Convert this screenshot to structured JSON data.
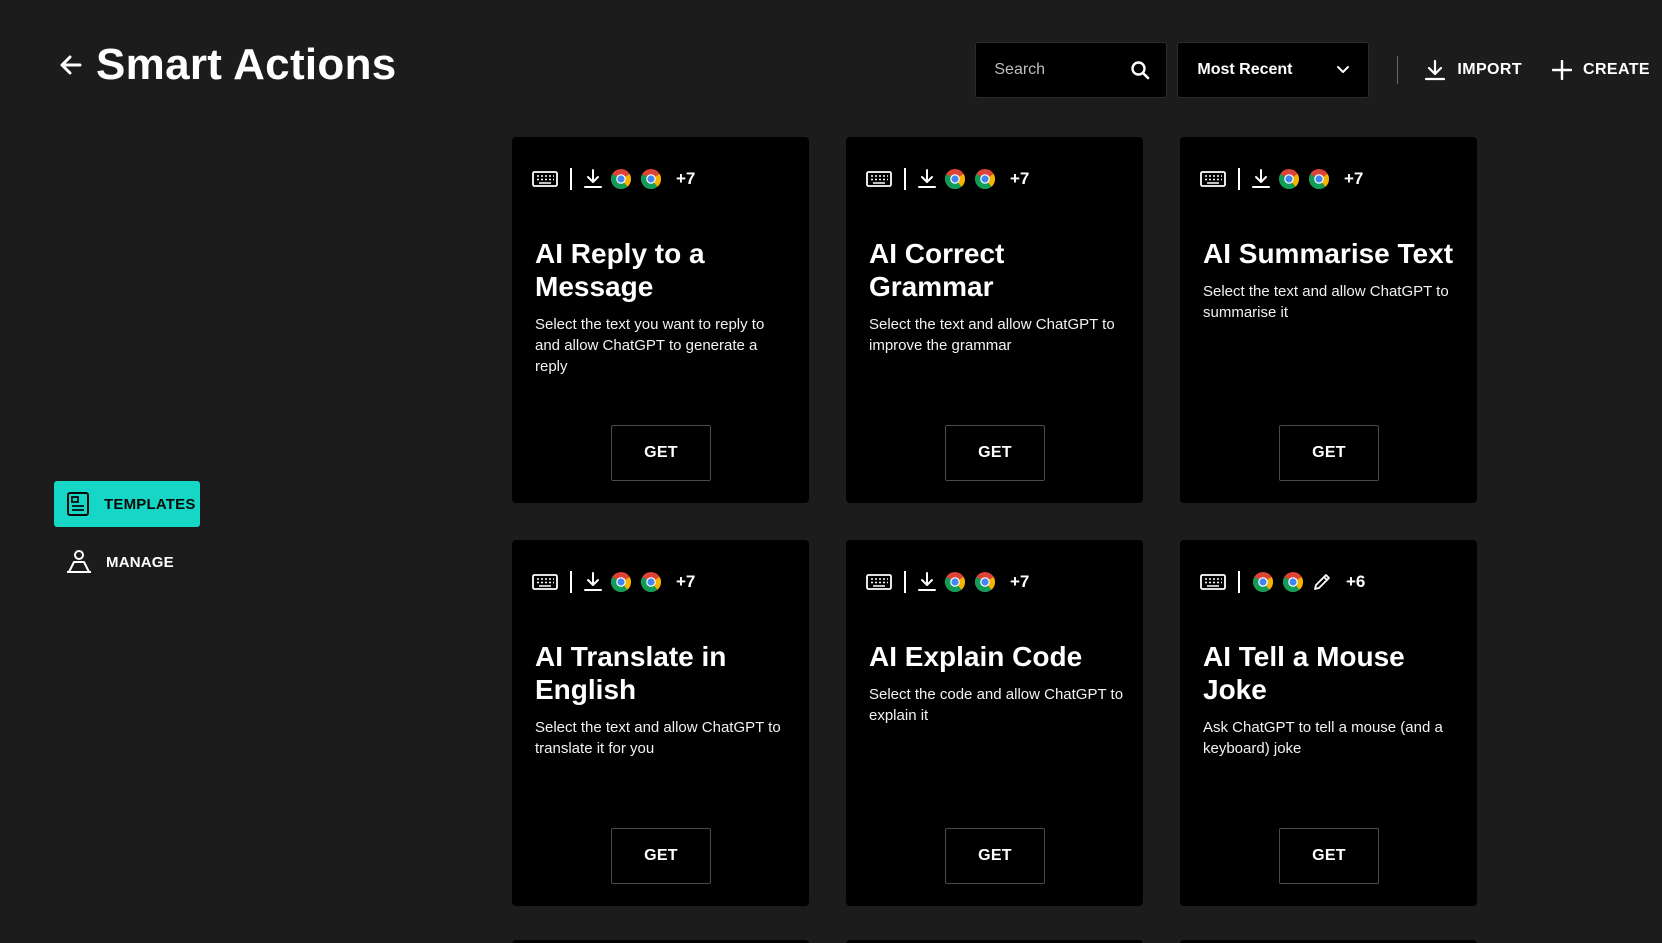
{
  "header": {
    "title": "Smart Actions",
    "search_placeholder": "Search",
    "sort_selected": "Most Recent",
    "import_label": "IMPORT",
    "create_label": "CREATE"
  },
  "sidebar": {
    "items": [
      {
        "label": "TEMPLATES",
        "icon": "templates-icon",
        "active": true
      },
      {
        "label": "MANAGE",
        "icon": "manage-icon",
        "active": false
      }
    ]
  },
  "colors": {
    "accent": "#16d6c5",
    "background": "#1c1c1c",
    "card": "#000000"
  },
  "cards": [
    {
      "title": "AI Reply to a Message",
      "description": "Select the text you want to reply to and allow ChatGPT to generate a reply",
      "icons": [
        "keyboard-icon",
        "download-icon",
        "chrome-icon",
        "chrome-icon"
      ],
      "more_count": "+7",
      "button_label": "GET"
    },
    {
      "title": "AI Correct Grammar",
      "description": "Select the text and allow ChatGPT to improve the grammar",
      "icons": [
        "keyboard-icon",
        "download-icon",
        "chrome-icon",
        "chrome-icon"
      ],
      "more_count": "+7",
      "button_label": "GET"
    },
    {
      "title": "AI Summarise Text",
      "description": "Select the text and allow ChatGPT to summarise it",
      "icons": [
        "keyboard-icon",
        "download-icon",
        "chrome-icon",
        "chrome-icon"
      ],
      "more_count": "+7",
      "button_label": "GET"
    },
    {
      "title": "AI Translate in English",
      "description": "Select the text and allow ChatGPT to translate it for you",
      "icons": [
        "keyboard-icon",
        "download-icon",
        "chrome-icon",
        "chrome-icon"
      ],
      "more_count": "+7",
      "button_label": "GET"
    },
    {
      "title": "AI Explain Code",
      "description": "Select the code and allow ChatGPT to explain it",
      "icons": [
        "keyboard-icon",
        "download-icon",
        "chrome-icon",
        "chrome-icon"
      ],
      "more_count": "+7",
      "button_label": "GET"
    },
    {
      "title": "AI Tell a Mouse Joke",
      "description": "Ask ChatGPT to tell a mouse (and a keyboard) joke",
      "icons": [
        "keyboard-icon",
        "chrome-icon",
        "chrome-icon",
        "pencil-icon"
      ],
      "more_count": "+6",
      "button_label": "GET"
    }
  ]
}
